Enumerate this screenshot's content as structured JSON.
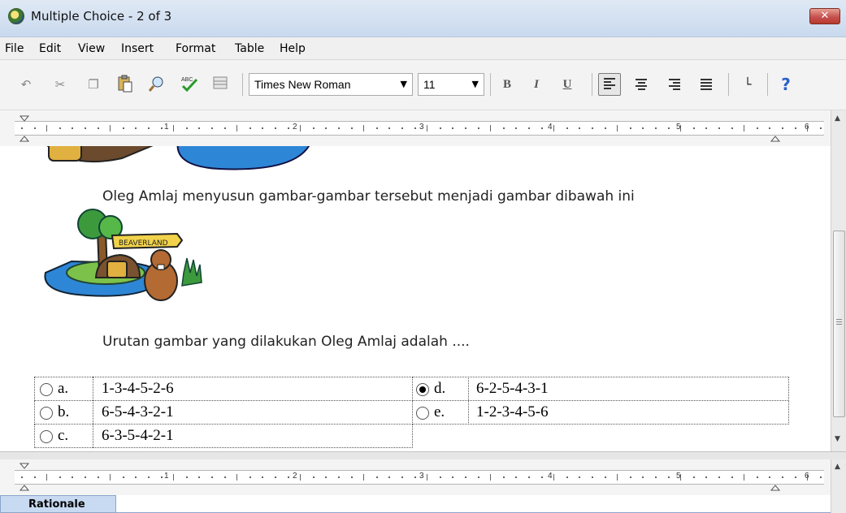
{
  "window": {
    "title": "Multiple Choice - 2 of 3",
    "close_glyph": "✕"
  },
  "menu": [
    "File",
    "Edit",
    "View",
    "Insert",
    "Format",
    "Table",
    "Help"
  ],
  "toolbar": {
    "font_name": "Times New Roman",
    "font_size": "11",
    "bold": "B",
    "italic": "I",
    "underline": "U",
    "help_glyph": "?",
    "icons": [
      "undo-icon",
      "cut-icon",
      "copy-icon",
      "paste-icon",
      "find-icon",
      "spellcheck-icon",
      "table-icon",
      "align-left-icon",
      "align-center-icon",
      "align-right-icon",
      "justify-icon",
      "tab-stop-icon",
      "help-icon"
    ]
  },
  "ruler": {
    "numbers": [
      "1",
      "2",
      "3",
      "4",
      "5",
      "6"
    ]
  },
  "document": {
    "line1": "Oleg Amlaj menyusun gambar-gambar tersebut menjadi gambar dibawah ini",
    "sign_text": "BEAVERLAND",
    "line2": "Urutan gambar yang dilakukan Oleg Amlaj adalah ...."
  },
  "answers": [
    {
      "letter": "a.",
      "value": "1-3-4-5-2-6",
      "selected": false
    },
    {
      "letter": "b.",
      "value": "6-5-4-3-2-1",
      "selected": false
    },
    {
      "letter": "c.",
      "value": "6-3-5-4-2-1",
      "selected": false
    },
    {
      "letter": "d.",
      "value": "6-2-5-4-3-1",
      "selected": true
    },
    {
      "letter": "e.",
      "value": "1-2-3-4-5-6",
      "selected": false
    }
  ],
  "bottom_tab": {
    "label": "Rationale"
  },
  "colors": {
    "title_bar": "#c9d9ee",
    "close_button": "#c75050",
    "tab_background": "#c8daf1",
    "water": "#2e86d6"
  }
}
